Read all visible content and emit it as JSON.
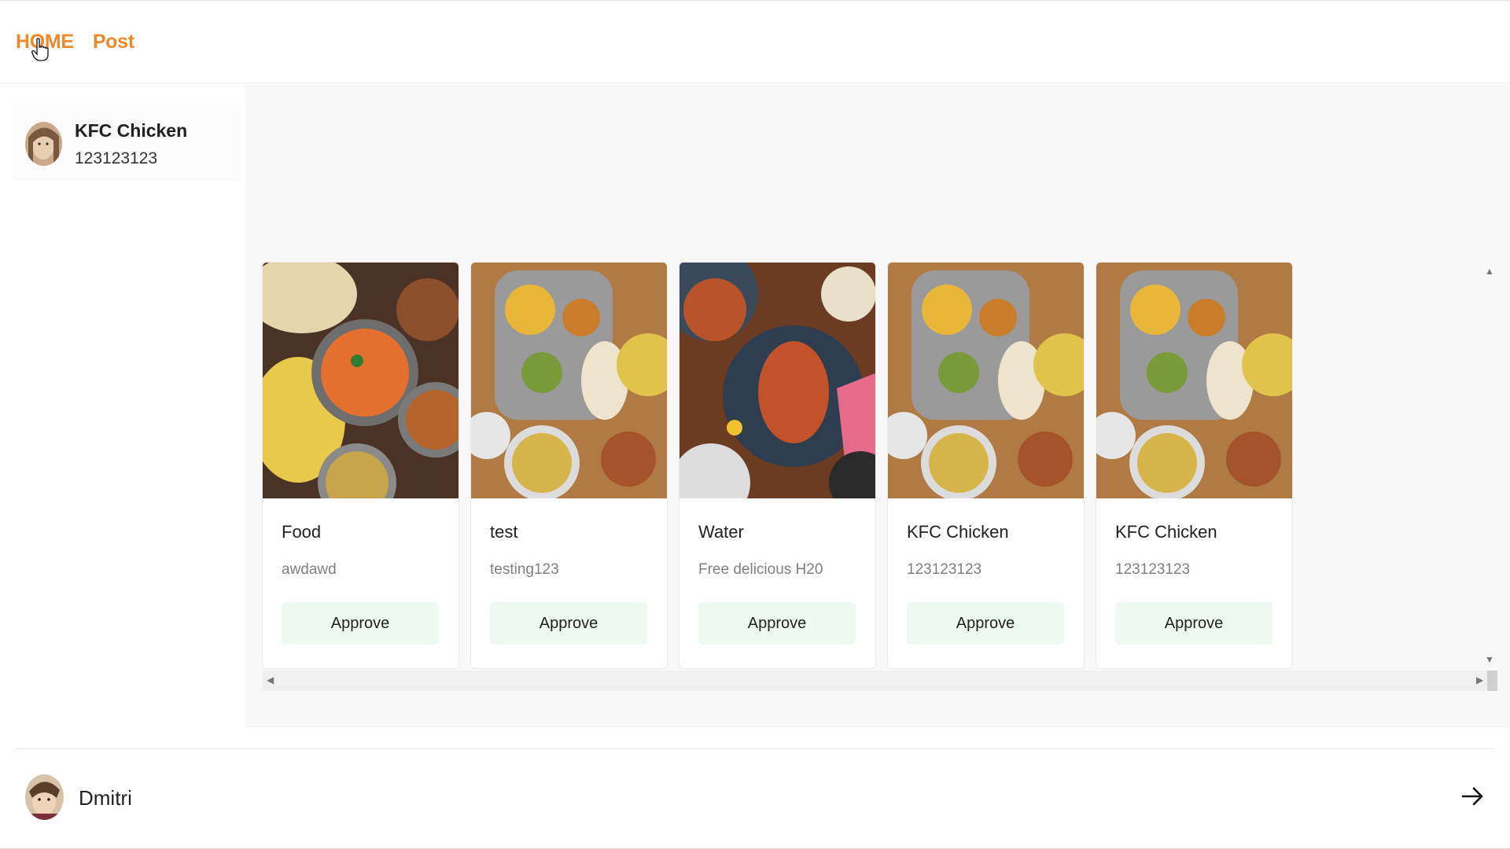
{
  "nav": {
    "home_label": "HOME",
    "post_label": "Post"
  },
  "sidebar": {
    "profile": {
      "name": "KFC Chicken",
      "subtitle": "123123123"
    }
  },
  "cards": [
    {
      "title": "Food",
      "description": "awdawd",
      "button": "Approve"
    },
    {
      "title": "test",
      "description": "testing123",
      "button": "Approve"
    },
    {
      "title": "Water",
      "description": "Free delicious H20",
      "button": "Approve"
    },
    {
      "title": "KFC Chicken",
      "description": "123123123",
      "button": "Approve"
    },
    {
      "title": "KFC Chicken",
      "description": "123123123",
      "button": "Approve"
    }
  ],
  "footer": {
    "user_name": "Dmitri"
  },
  "colors": {
    "accent": "#f0892b",
    "approve_bg": "#eef9f1"
  }
}
